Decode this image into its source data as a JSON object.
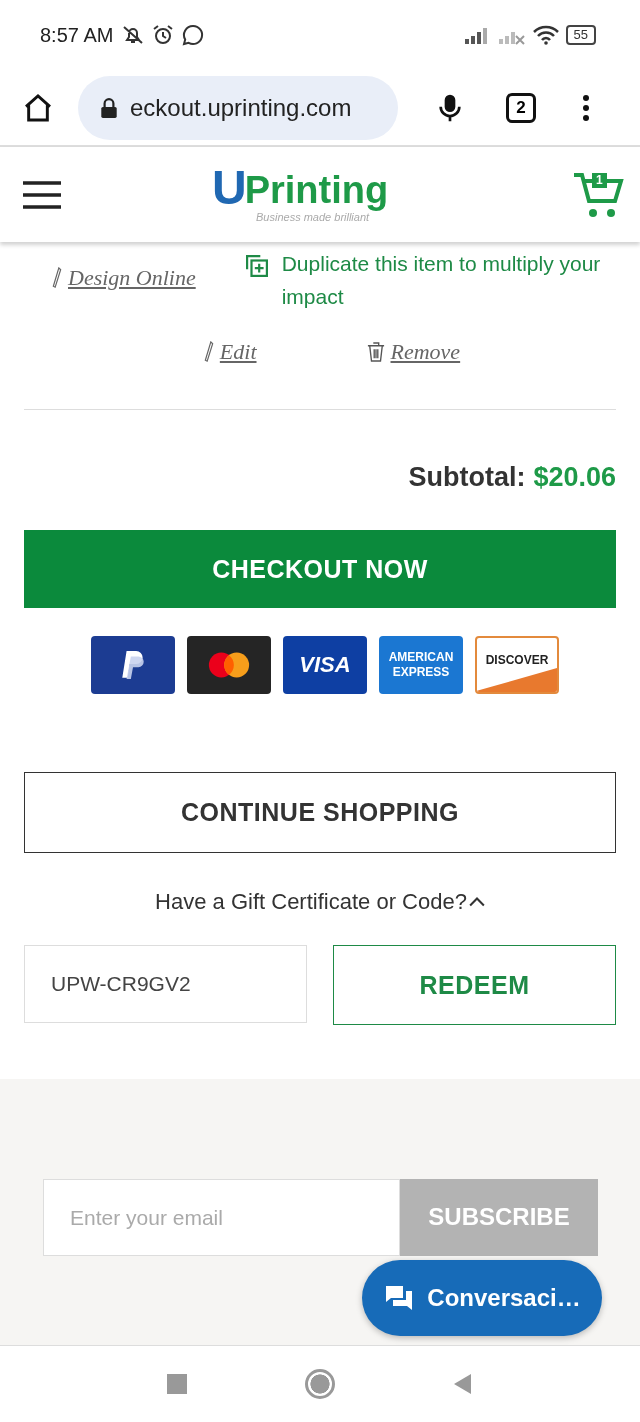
{
  "status_bar": {
    "time": "8:57 AM",
    "battery": "55"
  },
  "browser": {
    "url": "eckout.uprinting.com",
    "tab_count": "2"
  },
  "site_header": {
    "logo_mark": "U",
    "logo_name": "Printing",
    "tagline": "Business made brilliant",
    "cart_count": "1"
  },
  "item_actions": {
    "design_online": "Design Online",
    "duplicate": "Duplicate this item to multiply your impact",
    "edit": "Edit",
    "remove": "Remove"
  },
  "subtotal": {
    "label": "Subtotal:",
    "amount": "$20.06"
  },
  "checkout_button": "CHECKOUT NOW",
  "payment_methods": [
    {
      "kind": "paypal"
    },
    {
      "kind": "mastercard"
    },
    {
      "kind": "visa",
      "label": "VISA"
    },
    {
      "kind": "amex",
      "label": "AMERICAN EXPRESS"
    },
    {
      "kind": "discover",
      "label": "DISCOVER"
    }
  ],
  "continue_button": "CONTINUE SHOPPING",
  "gift_code": {
    "toggle": "Have a Gift Certificate or Code?",
    "expanded": true,
    "value": "UPW-CR9GV2",
    "button": "REDEEM"
  },
  "newsletter": {
    "placeholder": "Enter your email",
    "button": "SUBSCRIBE"
  },
  "chat_button": "Conversaci…"
}
